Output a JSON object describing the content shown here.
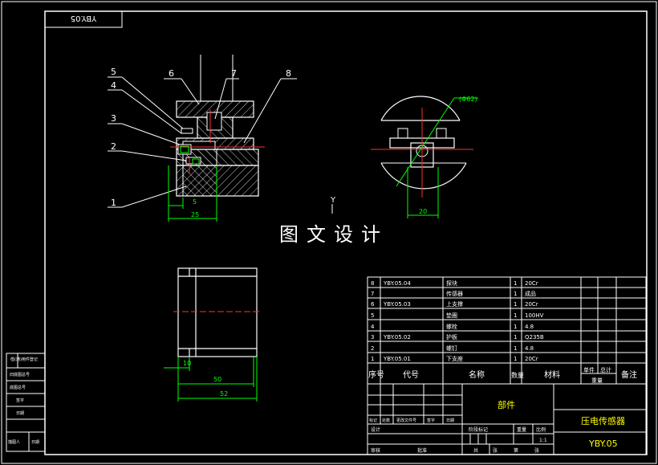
{
  "drawing": {
    "code_tag": "YBY.05",
    "watermark": "图文设计",
    "axis_label": "Y",
    "diameter_label": "(Φ62)",
    "dims": {
      "d5": "5",
      "d25": "25",
      "d20": "20",
      "d10": "10",
      "d50": "50",
      "d52": "52"
    },
    "balloons": [
      "5",
      "4",
      "3",
      "2",
      "1",
      "6",
      "7",
      "8"
    ]
  },
  "left_strip": {
    "labels": [
      "借(通)用件登记",
      "旧底图总号",
      "底图总号",
      "签字",
      "日期",
      "描图人",
      "日期"
    ]
  },
  "bom": {
    "rows": [
      {
        "no": "8",
        "code": "YBY.05.04",
        "name": "探块",
        "qty": "1",
        "material": "20Cr"
      },
      {
        "no": "7",
        "code": "",
        "name": "传感器",
        "qty": "1",
        "material": "成品"
      },
      {
        "no": "6",
        "code": "YBY.05.03",
        "name": "上支撑",
        "qty": "1",
        "material": "20Cr"
      },
      {
        "no": "5",
        "code": "",
        "name": "垫圈",
        "qty": "1",
        "material": "100HV"
      },
      {
        "no": "4",
        "code": "",
        "name": "螺栓",
        "qty": "1",
        "material": "4.8"
      },
      {
        "no": "3",
        "code": "YBY.05.02",
        "name": "护板",
        "qty": "1",
        "material": "Q235B"
      },
      {
        "no": "2",
        "code": "",
        "name": "螺钉",
        "qty": "1",
        "material": "4.8"
      },
      {
        "no": "1",
        "code": "YBY.05.01",
        "name": "下支座",
        "qty": "1",
        "material": "20Cr"
      }
    ],
    "header": {
      "no": "序号",
      "code": "代号",
      "name": "名称",
      "qty": "数量",
      "material": "材料",
      "unit_weight": "单件",
      "total_weight": "总计",
      "weight": "重量",
      "remark": "备注"
    }
  },
  "title_block": {
    "part_type": "部件",
    "product_name": "压电传感器",
    "drawing_code": "YBY.05",
    "scale": "1:1",
    "mark_label": "标记",
    "qty_label": "处数",
    "file_label": "更改文件号",
    "sign_label": "签字",
    "date_label": "日期",
    "design_label": "设计",
    "stage_label": "阶段标记",
    "weight_label": "重量",
    "scale_label": "比例",
    "total_label": "共",
    "sheet_label": "张",
    "page_label": "第",
    "check_label": "审核",
    "approve_label": "批准"
  }
}
